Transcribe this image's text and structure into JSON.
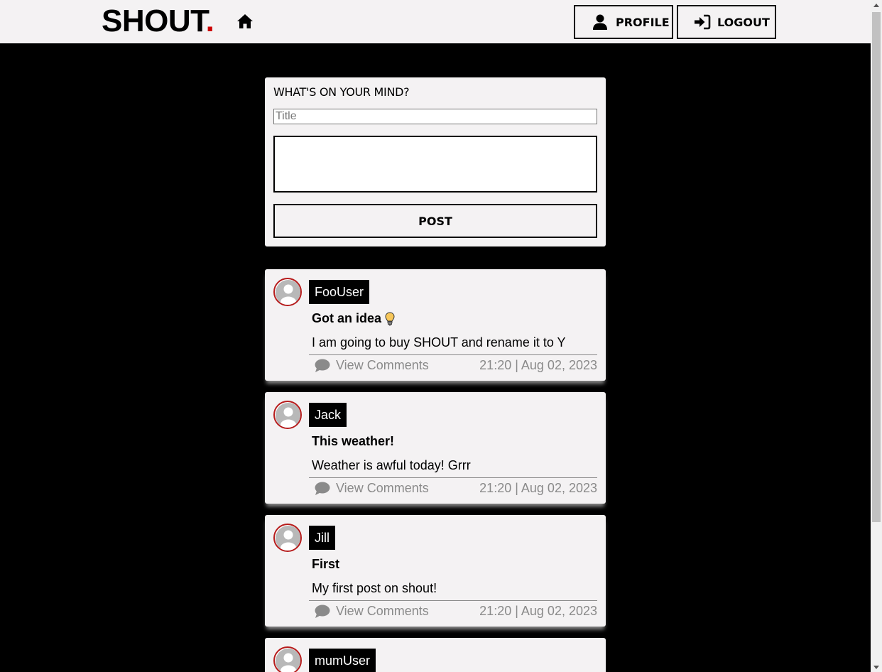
{
  "header": {
    "logo_text": "SHOUT",
    "logo_dot": ".",
    "logo_dot_color": "#cc0000",
    "home_icon": "home-icon",
    "profile_label": "PROFILE",
    "logout_label": "LOGOUT"
  },
  "composer": {
    "heading": "WHAT'S ON YOUR MIND?",
    "title_placeholder": "Title",
    "title_value": "",
    "body_value": "",
    "post_label": "POST"
  },
  "posts": [
    {
      "username": "FooUser",
      "title": "Got an idea",
      "title_icon": "lightbulb-icon",
      "body": "I am going to buy SHOUT and rename it to Y",
      "comments_label": "View Comments",
      "timestamp": "21:20 | Aug 02, 2023"
    },
    {
      "username": "Jack",
      "title": "This weather!",
      "body": "Weather is awful today! Grrr",
      "comments_label": "View Comments",
      "timestamp": "21:20 | Aug 02, 2023"
    },
    {
      "username": "Jill",
      "title": "First",
      "body": "My first post on shout!",
      "comments_label": "View Comments",
      "timestamp": "21:20 | Aug 02, 2023"
    },
    {
      "username": "mumUser"
    }
  ],
  "colors": {
    "background": "#000000",
    "card": "#f4f2f3",
    "avatar_ring": "#b71c1c",
    "muted_text": "#8a8a8a"
  }
}
